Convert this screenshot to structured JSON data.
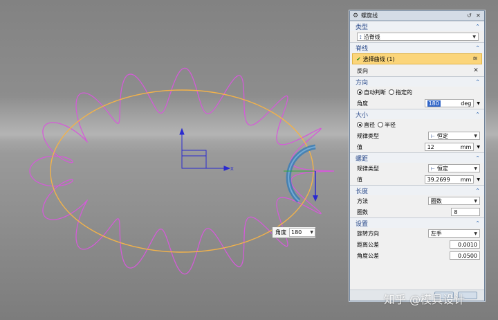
{
  "dialog": {
    "title": "螺旋线",
    "sections": {
      "type": {
        "header": "类型",
        "value": "沿脊线"
      },
      "spine": {
        "header": "脊线",
        "select_curve": "选择曲线 (1)",
        "reverse": "反向"
      },
      "direction": {
        "header": "方向",
        "radio_auto": "自动判断",
        "radio_specified": "指定的",
        "angle_label": "角度",
        "angle_value": "180",
        "angle_unit": "deg"
      },
      "size": {
        "header": "大小",
        "radio_diameter": "直径",
        "radio_radius": "半径",
        "law_label": "规律类型",
        "law_value": "恒定",
        "value_label": "值",
        "value": "12",
        "unit": "mm"
      },
      "pitch": {
        "header": "螺距",
        "law_label": "规律类型",
        "law_value": "恒定",
        "value_label": "值",
        "value": "39.2699",
        "unit": "mm"
      },
      "length": {
        "header": "长度",
        "method_label": "方法",
        "method_value": "圈数",
        "turns_label": "圈数",
        "turns_value": "8"
      },
      "settings": {
        "header": "设置",
        "rotation_label": "旋转方向",
        "rotation_value": "左手",
        "dist_tol_label": "距离公差",
        "dist_tol_value": "0.0010",
        "angle_tol_label": "角度公差",
        "angle_tol_value": "0.0500"
      }
    }
  },
  "viewport": {
    "axis_x": "X",
    "angle_input_label": "角度",
    "angle_input_value": "180"
  },
  "watermark": "知乎 @模具设计",
  "colors": {
    "helix": "#d45bd8",
    "curve": "#f2b24a",
    "axis": "#2a2ad0",
    "highlight": "#fbd57a"
  }
}
